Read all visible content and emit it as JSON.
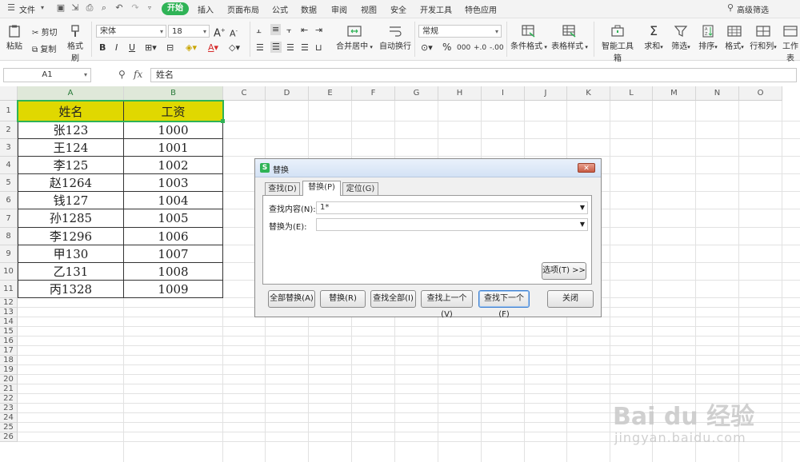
{
  "menu": {
    "file": "文件",
    "tabs": [
      "开始",
      "插入",
      "页面布局",
      "公式",
      "数据",
      "审阅",
      "视图",
      "安全",
      "开发工具",
      "特色应用"
    ],
    "advanced_filter": "高级筛选"
  },
  "ribbon": {
    "paste": "粘贴",
    "cut": "剪切",
    "copy": "复制",
    "format_painter": "格式刷",
    "font_name": "宋体",
    "font_size": "18",
    "merge_center": "合并居中",
    "wrap_text": "自动换行",
    "number_format": "常规",
    "conditional_format": "条件格式",
    "table_style": "表格样式",
    "smart_toolbox": "智能工具箱",
    "sum": "求和",
    "filter": "筛选",
    "sort": "排序",
    "format": "格式",
    "row_col": "行和列",
    "worksheet": "工作表",
    "pct": "%",
    "comma": "000",
    "dec_inc": "+.0",
    "dec_dec": "-.00"
  },
  "formula_bar": {
    "name_box": "A1",
    "fx": "fx",
    "content": "姓名"
  },
  "grid": {
    "columns": [
      "A",
      "B",
      "C",
      "D",
      "E",
      "F",
      "G",
      "H",
      "I",
      "J",
      "K",
      "L",
      "M",
      "N",
      "O"
    ],
    "rows": [
      "1",
      "2",
      "3",
      "4",
      "5",
      "6",
      "7",
      "8",
      "9",
      "10",
      "11",
      "12",
      "13",
      "14",
      "15",
      "16",
      "17",
      "18",
      "19",
      "20",
      "21",
      "22",
      "23",
      "24",
      "25",
      "26"
    ],
    "header": [
      "姓名",
      "工资"
    ],
    "data": [
      [
        "张123",
        "1000"
      ],
      [
        "王124",
        "1001"
      ],
      [
        "李125",
        "1002"
      ],
      [
        "赵1264",
        "1003"
      ],
      [
        "钱127",
        "1004"
      ],
      [
        "孙1285",
        "1005"
      ],
      [
        "李1296",
        "1006"
      ],
      [
        "甲130",
        "1007"
      ],
      [
        "乙131",
        "1008"
      ],
      [
        "丙1328",
        "1009"
      ]
    ],
    "header_color": "#e0d800"
  },
  "dialog": {
    "title": "替换",
    "tabs": [
      "查找(D)",
      "替换(P)",
      "定位(G)"
    ],
    "find_label": "查找内容(N):",
    "find_value": "1*",
    "replace_label": "替换为(E):",
    "replace_value": "",
    "options_button": "选项(T) >>",
    "buttons": [
      "全部替换(A)",
      "替换(R)",
      "查找全部(I)",
      "查找上一个(V)",
      "查找下一个(F)",
      "关闭"
    ]
  },
  "watermark": {
    "logo": "Bai du 经验",
    "url": "jingyan.baidu.com"
  },
  "colors": {
    "accent": "#2fb356",
    "header_fill": "#e0d800"
  }
}
